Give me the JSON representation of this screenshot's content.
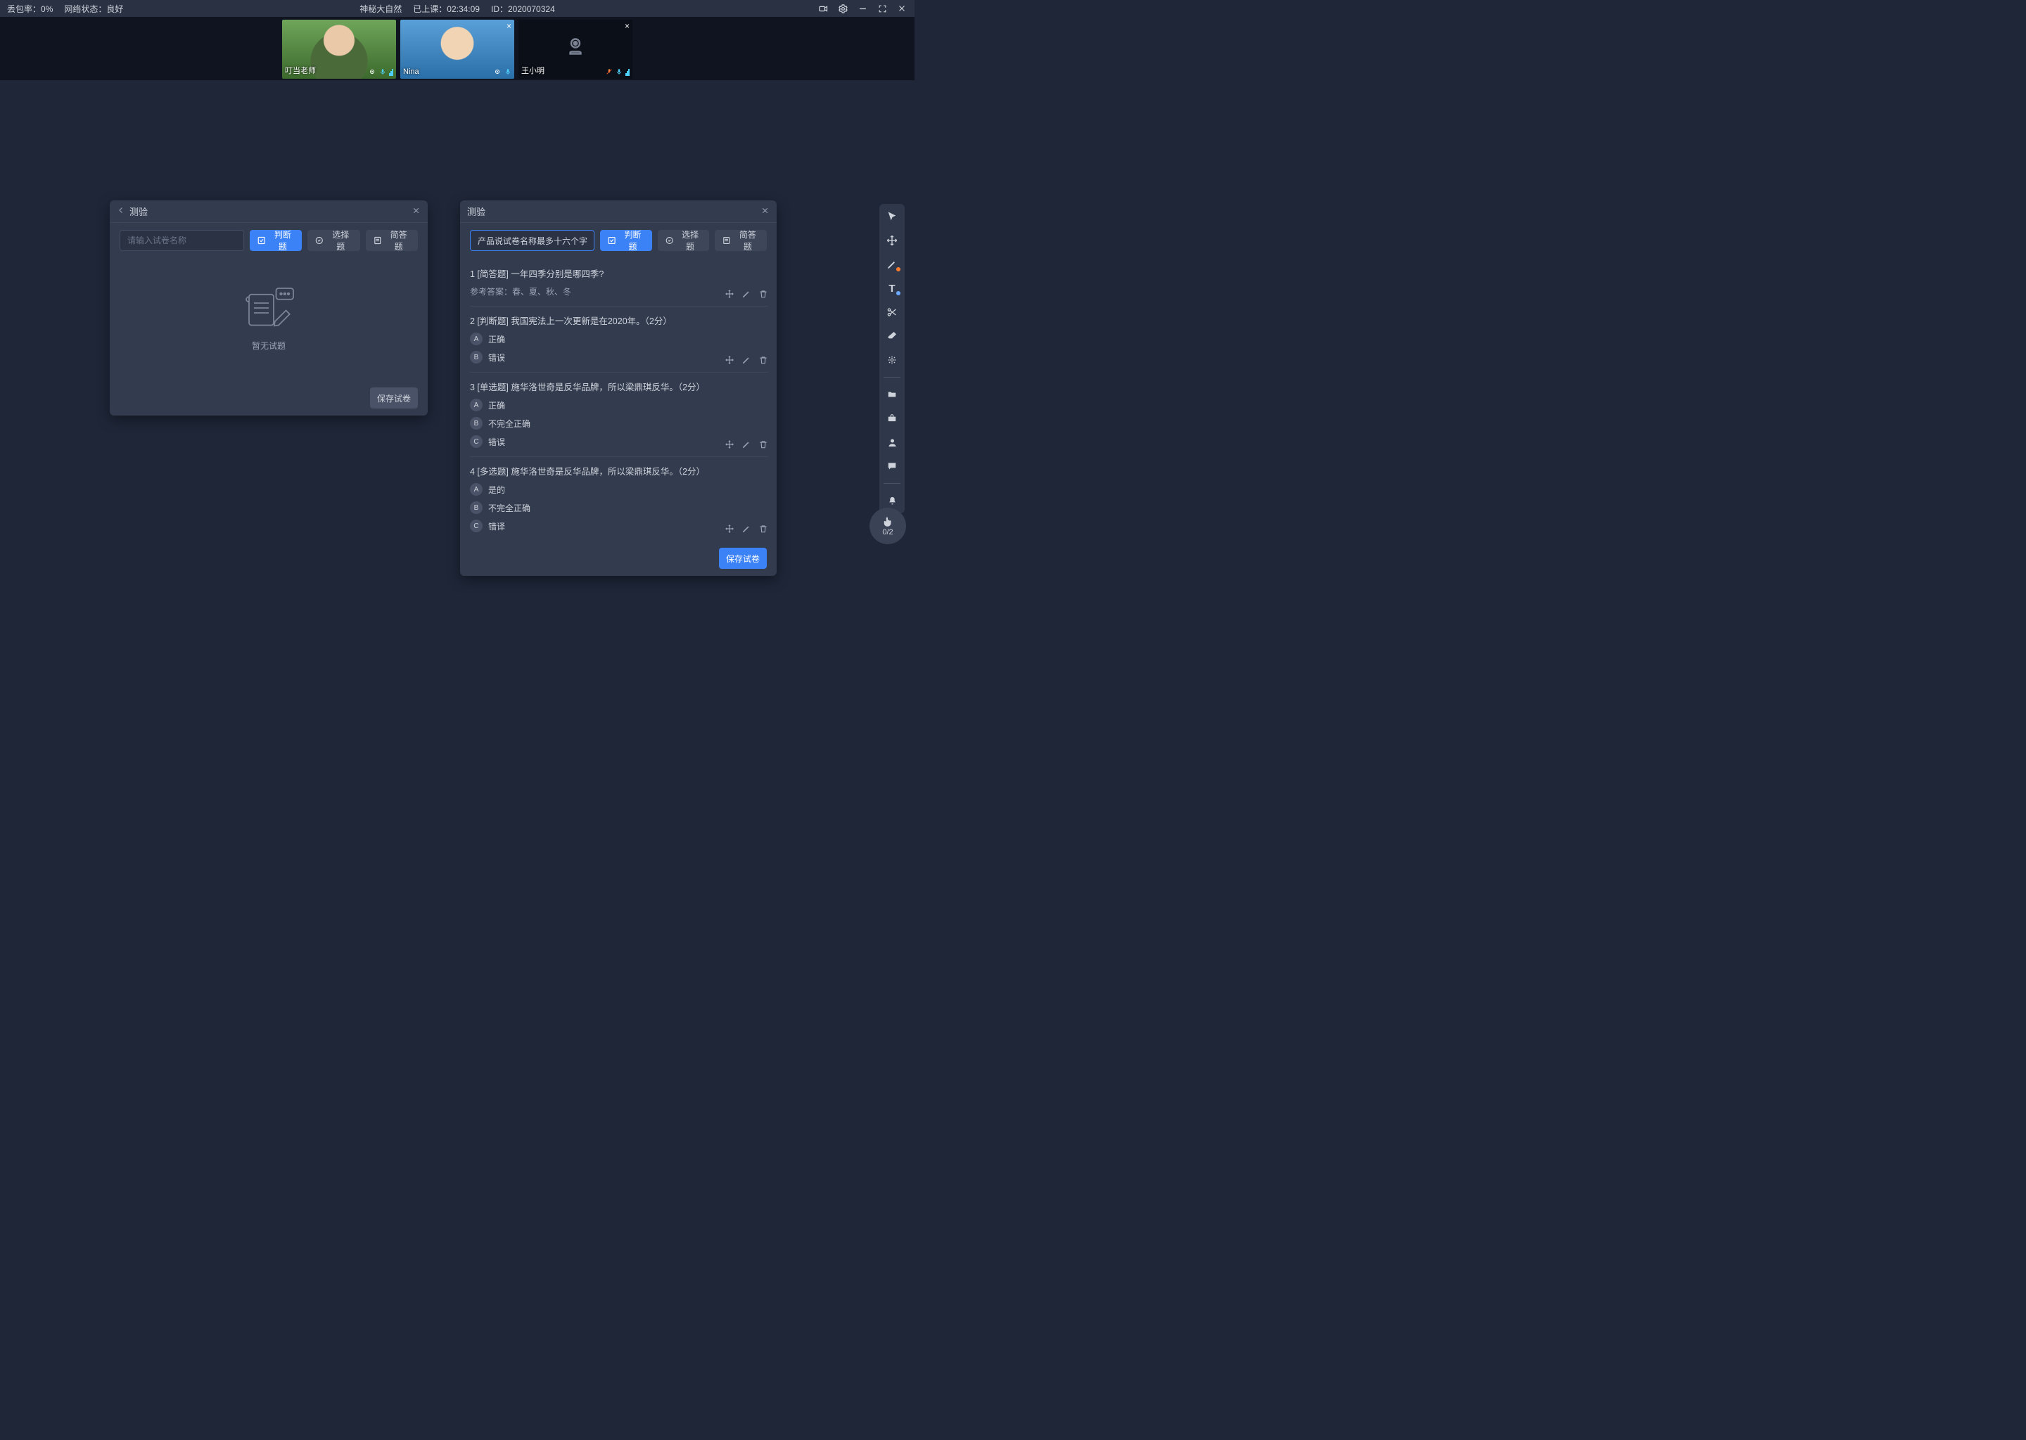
{
  "status": {
    "packet_loss_label": "丢包率：",
    "packet_loss_value": "0%",
    "network_label": "网络状态：",
    "network_value": "良好",
    "class_title": "神秘大自然",
    "elapsed_label": "已上课：",
    "elapsed_value": "02:34:09",
    "id_label": "ID：",
    "id_value": "2020070324"
  },
  "tiles": [
    {
      "name": "叮当老师",
      "camera_on": true,
      "closable": false
    },
    {
      "name": "Nina",
      "camera_on": true,
      "closable": true
    },
    {
      "name": "王小明",
      "camera_on": false,
      "closable": true
    }
  ],
  "toolrail": {
    "items": [
      "cursor-icon",
      "move-icon",
      "pen-icon",
      "text-icon",
      "scissors-icon",
      "eraser-icon",
      "laser-icon",
      "folder-icon",
      "toolbox-icon",
      "person-icon",
      "chat-icon",
      "bell-icon"
    ]
  },
  "hand": {
    "count": "0/2"
  },
  "panel_left": {
    "title": "测验",
    "input_placeholder": "请输入试卷名称",
    "btn_judge": "判断题",
    "btn_choice": "选择题",
    "btn_short": "简答题",
    "empty": "暂无试题",
    "save": "保存试卷"
  },
  "panel_right": {
    "title": "测验",
    "input_value": "产品说试卷名称最多十六个字",
    "btn_judge": "判断题",
    "btn_choice": "选择题",
    "btn_short": "简答题",
    "save": "保存试卷",
    "questions": [
      {
        "header": "1 [简答题] 一年四季分别是哪四季?",
        "answer_line": "参考答案：春、夏、秋、冬",
        "options": []
      },
      {
        "header": "2 [判断题] 我国宪法上一次更新是在2020年。（2分）",
        "options": [
          {
            "letter": "A",
            "text": "正确"
          },
          {
            "letter": "B",
            "text": "错误"
          }
        ]
      },
      {
        "header": "3 [单选题] 施华洛世奇是反华品牌，所以梁鼎琪反华。（2分）",
        "options": [
          {
            "letter": "A",
            "text": "正确"
          },
          {
            "letter": "B",
            "text": "不完全正确"
          },
          {
            "letter": "C",
            "text": "错误"
          }
        ]
      },
      {
        "header": "4 [多选题] 施华洛世奇是反华品牌，所以梁鼎琪反华。（2分）",
        "options": [
          {
            "letter": "A",
            "text": "是的"
          },
          {
            "letter": "B",
            "text": "不完全正确"
          },
          {
            "letter": "C",
            "text": "错译"
          }
        ]
      }
    ]
  }
}
